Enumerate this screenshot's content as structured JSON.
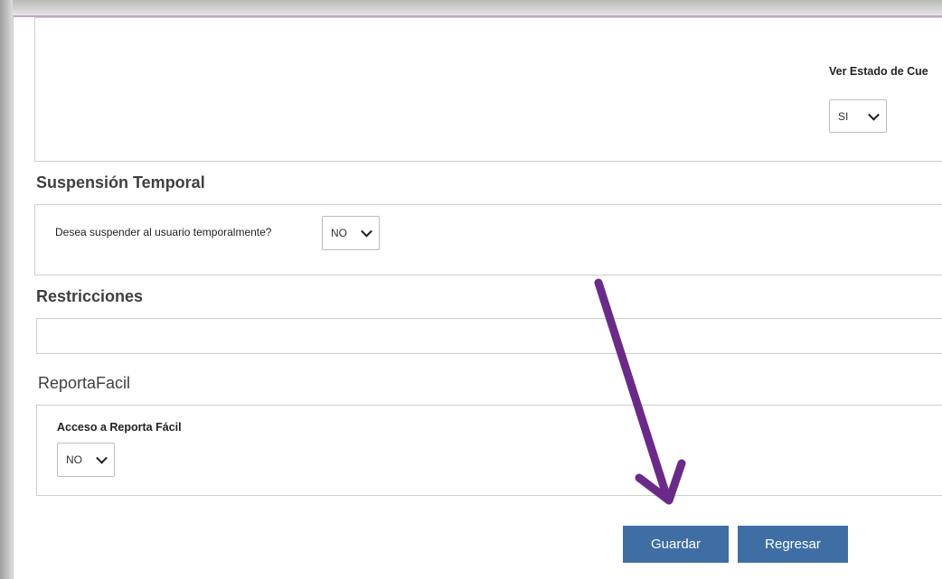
{
  "colors": {
    "button_bg": "#3f6ea5",
    "arrow": "#6a2a8a",
    "accent_line": "#c9a3c9"
  },
  "top_panel": {
    "label": "Ver Estado de Cue",
    "select_value": "SI",
    "select_icon": "chevron-down-icon"
  },
  "suspension": {
    "title": "Suspensión Temporal",
    "question": "Desea suspender al usuario temporalmente?",
    "select_value": "NO",
    "select_icon": "chevron-down-icon"
  },
  "restricciones": {
    "title": "Restricciones"
  },
  "reportafacil": {
    "title": "ReportaFacil",
    "label": "Acceso a Reporta Fácil",
    "select_value": "NO",
    "select_icon": "chevron-down-icon"
  },
  "annotation": {
    "icon": "arrow-annotation-icon"
  },
  "buttons": {
    "save": "Guardar",
    "back": "Regresar"
  }
}
